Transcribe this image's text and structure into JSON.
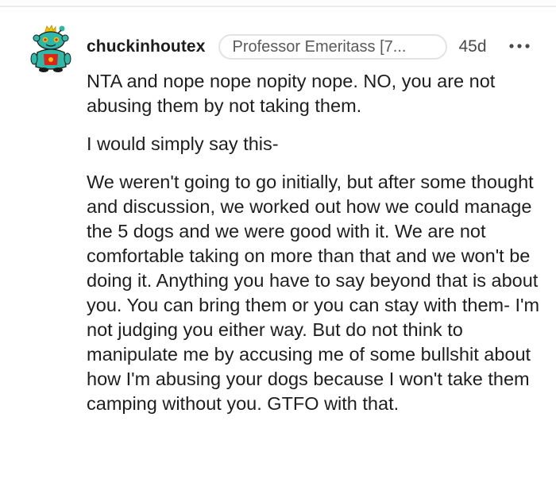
{
  "comment": {
    "username": "chuckinhoutex",
    "flair": "Professor Emeritass [7...",
    "age": "45d",
    "more_icon": "ellipsis-horizontal-icon",
    "avatar_icon": "snoo-avatar-icon",
    "paragraphs": [
      "NTA and nope nope nopity nope. NO, you are not abusing them by not taking them.",
      "I would simply say this-",
      "We weren't going to go initially, but after some thought and discussion, we worked out how we could manage the 5 dogs and we were good with it. We are not comfortable taking on more than that and we won't be doing it. Anything you have to say beyond that is about you. You can bring them or you can stay with them- I'm not judging you either way. But do not think to manipulate me by accusing me of some bullshit about how I'm abusing your dogs because I won't take them camping without you. GTFO with that."
    ]
  },
  "colors": {
    "text": "#1e1e1e",
    "meta": "#5a5a5a",
    "border": "#e3e3e3",
    "avatar_teal": "#2fb8a7",
    "avatar_red": "#d9261c",
    "avatar_yellow": "#f5c400"
  }
}
